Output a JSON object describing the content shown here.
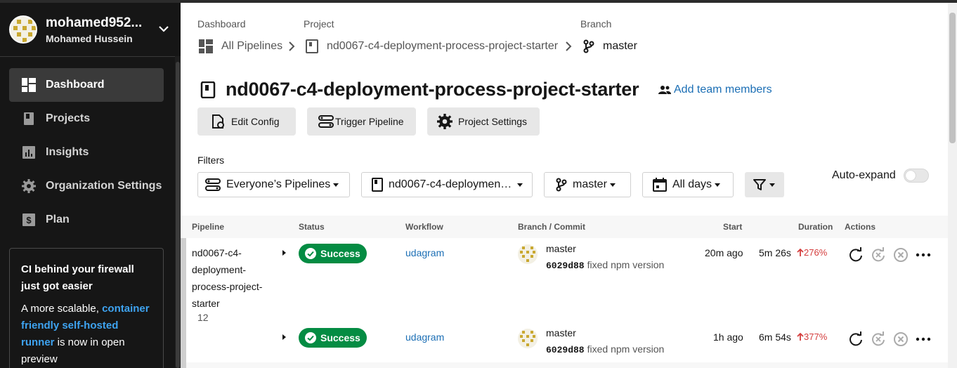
{
  "user": {
    "handle": "mohamed952...",
    "name": "Mohamed Hussein"
  },
  "sidebar": {
    "items": [
      {
        "label": "Dashboard",
        "icon": "dashboard-icon",
        "active": true
      },
      {
        "label": "Projects",
        "icon": "book-icon"
      },
      {
        "label": "Insights",
        "icon": "insights-icon"
      },
      {
        "label": "Organization Settings",
        "icon": "gear-icon"
      },
      {
        "label": "Plan",
        "icon": "dollar-icon"
      }
    ],
    "promo": {
      "title": "CI behind your firewall just got easier",
      "body_before": "A more scalable, ",
      "link": "container friendly self-hosted runner",
      "body_after": " is now in open preview"
    }
  },
  "breadcrumb": {
    "dashboard_label": "Dashboard",
    "dashboard_value": "All Pipelines",
    "project_label": "Project",
    "project_value": "nd0067-c4-deployment-process-project-starter",
    "branch_label": "Branch",
    "branch_value": "master"
  },
  "project": {
    "title": "nd0067-c4-deployment-process-project-starter",
    "add_team": "Add team members"
  },
  "buttons": {
    "edit_config": "Edit Config",
    "trigger_pipeline": "Trigger Pipeline",
    "project_settings": "Project Settings"
  },
  "filters": {
    "label": "Filters",
    "pipelines": "Everyone’s Pipelines",
    "project": "nd0067-c4-deploymen…",
    "branch": "master",
    "days": "All days",
    "auto_expand": "Auto-expand"
  },
  "table": {
    "headers": {
      "pipeline": "Pipeline",
      "status": "Status",
      "workflow": "Workflow",
      "branch_commit": "Branch / Commit",
      "start": "Start",
      "duration": "Duration",
      "actions": "Actions"
    },
    "pipeline_name": "nd0067-c4-deployment-process-project-starter",
    "pipeline_number": "12",
    "rows": [
      {
        "status": "Success",
        "workflow": "udagram",
        "branch": "master",
        "commit_hash": "6029d88",
        "commit_msg": "fixed npm version",
        "start": "20m ago",
        "duration": "5m 26s",
        "delta": "276%"
      },
      {
        "status": "Success",
        "workflow": "udagram",
        "branch": "master",
        "commit_hash": "6029d88",
        "commit_msg": "fixed npm version",
        "start": "1h ago",
        "duration": "6m 54s",
        "delta": "377%"
      }
    ]
  },
  "colors": {
    "success": "#048c43",
    "link": "#1c6fb5",
    "sidebar": "#161616",
    "regression": "#d43c3c"
  }
}
